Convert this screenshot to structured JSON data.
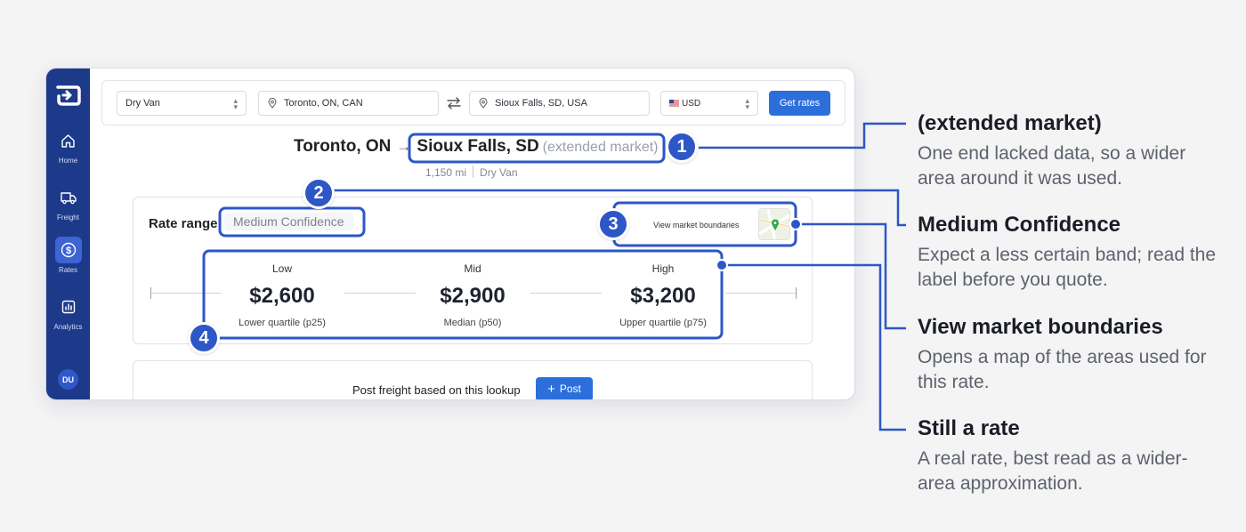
{
  "sidebar": {
    "items": [
      {
        "label": "Home",
        "icon": "home-icon"
      },
      {
        "label": "Freight",
        "icon": "truck-icon"
      },
      {
        "label": "Rates",
        "icon": "dollar-icon"
      },
      {
        "label": "Analytics",
        "icon": "chart-icon"
      }
    ],
    "avatar": "DU"
  },
  "search": {
    "equipment": "Dry Van",
    "origin": "Toronto, ON, CAN",
    "destination": "Sioux Falls, SD, USA",
    "currency": "USD",
    "get_rates": "Get rates"
  },
  "route": {
    "origin": "Toronto, ON",
    "destination": "Sioux Falls, SD",
    "extended": "(extended market)",
    "distance": "1,150 mi",
    "equipment": "Dry Van"
  },
  "rate_card": {
    "title": "Rate range",
    "confidence": "Medium Confidence",
    "view_market": "View market boundaries",
    "low": {
      "label": "Low",
      "value": "$2,600",
      "sub": "Lower quartile (p25)"
    },
    "mid": {
      "label": "Mid",
      "value": "$2,900",
      "sub": "Median (p50)"
    },
    "high": {
      "label": "High",
      "value": "$3,200",
      "sub": "Upper quartile (p75)"
    }
  },
  "post": {
    "text": "Post freight based on this lookup",
    "button": "Post"
  },
  "callouts": [
    "1",
    "2",
    "3",
    "4"
  ],
  "notes": [
    {
      "title": "(extended market)",
      "body": "One end lacked data, so a wider area around it was used."
    },
    {
      "title": "Medium Confidence",
      "body": "Expect a less certain band; read the label before you quote."
    },
    {
      "title": "View market boundaries",
      "body": "Opens a map of the areas used for this rate."
    },
    {
      "title": "Still a rate",
      "body": "A real rate, best read as a wider-area approximation."
    }
  ],
  "colors": {
    "sidebar": "#1d3a8a",
    "accent": "#2c6fdb",
    "callout": "#2d57c6"
  }
}
